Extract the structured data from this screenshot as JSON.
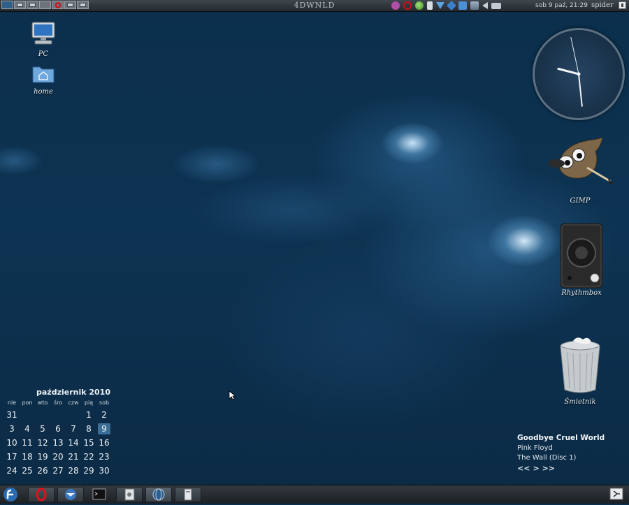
{
  "top_panel": {
    "window_title": "4DWNLD",
    "clock": "sob  9 paź, 21:29",
    "user": "spider"
  },
  "desktop_icons": {
    "pc": "PC",
    "home": "home",
    "gimp": "GIMP",
    "rhythmbox": "Rhythmbox",
    "trash": "Śmietnik"
  },
  "calendar": {
    "title": "październik 2010",
    "weekdays": [
      "nie",
      "pon",
      "wto",
      "śro",
      "czw",
      "pią",
      "sob"
    ],
    "weeks": [
      [
        "31",
        "",
        "",
        "",
        "",
        "1",
        "2"
      ],
      [
        "3",
        "4",
        "5",
        "6",
        "7",
        "8",
        "9"
      ],
      [
        "10",
        "11",
        "12",
        "13",
        "14",
        "15",
        "16"
      ],
      [
        "17",
        "18",
        "19",
        "20",
        "21",
        "22",
        "23"
      ],
      [
        "24",
        "25",
        "26",
        "27",
        "28",
        "29",
        "30"
      ]
    ],
    "today": "9"
  },
  "music": {
    "song": "Goodbye Cruel World",
    "artist": "Pink Floyd",
    "album": "The Wall (Disc 1)",
    "prev": "<<",
    "play": ">",
    "next": ">>"
  },
  "clock_widget": {
    "hour": 9,
    "minute": 29,
    "second": 58
  },
  "colors": {
    "accent": "#3a6e96",
    "desktop": "#0d3352"
  },
  "icons": {
    "tray": [
      "pidgin-icon",
      "opera-icon",
      "update-icon",
      "battery-icon",
      "download-icon",
      "network-icon",
      "clipboard-icon",
      "vmware-icon",
      "volume-icon",
      "display-icon"
    ],
    "taskbar": [
      "fedora-menu-icon",
      "opera-icon",
      "thunderbird-icon",
      "terminal-icon",
      "image-viewer-icon",
      "globe-icon",
      "file-manager-icon",
      "show-desktop-icon"
    ]
  }
}
